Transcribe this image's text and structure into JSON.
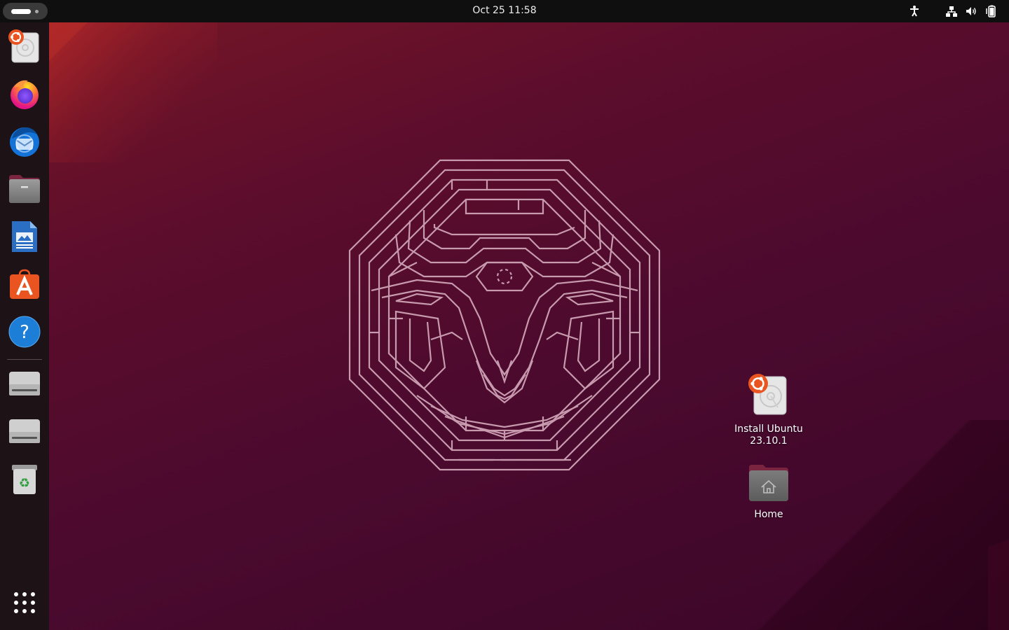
{
  "topbar": {
    "clock": "Oct 25  11:58",
    "activities": "Activities",
    "tray": [
      "accessibility-icon",
      "network-icon",
      "volume-icon",
      "battery-icon"
    ]
  },
  "dock": {
    "items": [
      {
        "name": "install-ubuntu",
        "icon": "installer-icon"
      },
      {
        "name": "firefox",
        "icon": "firefox-icon"
      },
      {
        "name": "thunderbird",
        "icon": "thunderbird-icon"
      },
      {
        "name": "files",
        "icon": "files-icon"
      },
      {
        "name": "libreoffice-writer",
        "icon": "writer-icon"
      },
      {
        "name": "app-center",
        "icon": "app-center-icon"
      },
      {
        "name": "help",
        "icon": "help-icon"
      },
      {
        "name": "drive-1",
        "icon": "drive-icon"
      },
      {
        "name": "drive-2",
        "icon": "drive-icon"
      },
      {
        "name": "trash",
        "icon": "trash-icon"
      },
      {
        "name": "show-apps",
        "icon": "app-grid-icon"
      }
    ]
  },
  "desktop_icons": [
    {
      "label": "Install Ubuntu\n23.10.1",
      "line1": "Install Ubuntu",
      "line2": "23.10.1",
      "icon": "installer-icon"
    },
    {
      "label": "Home",
      "icon": "home-folder-icon"
    }
  ],
  "colors": {
    "accent": "#e95420",
    "wallpaper_dark": "#4a0a2e",
    "wallpaper_red": "#a52a2a",
    "maze_line": "#c89aae"
  }
}
